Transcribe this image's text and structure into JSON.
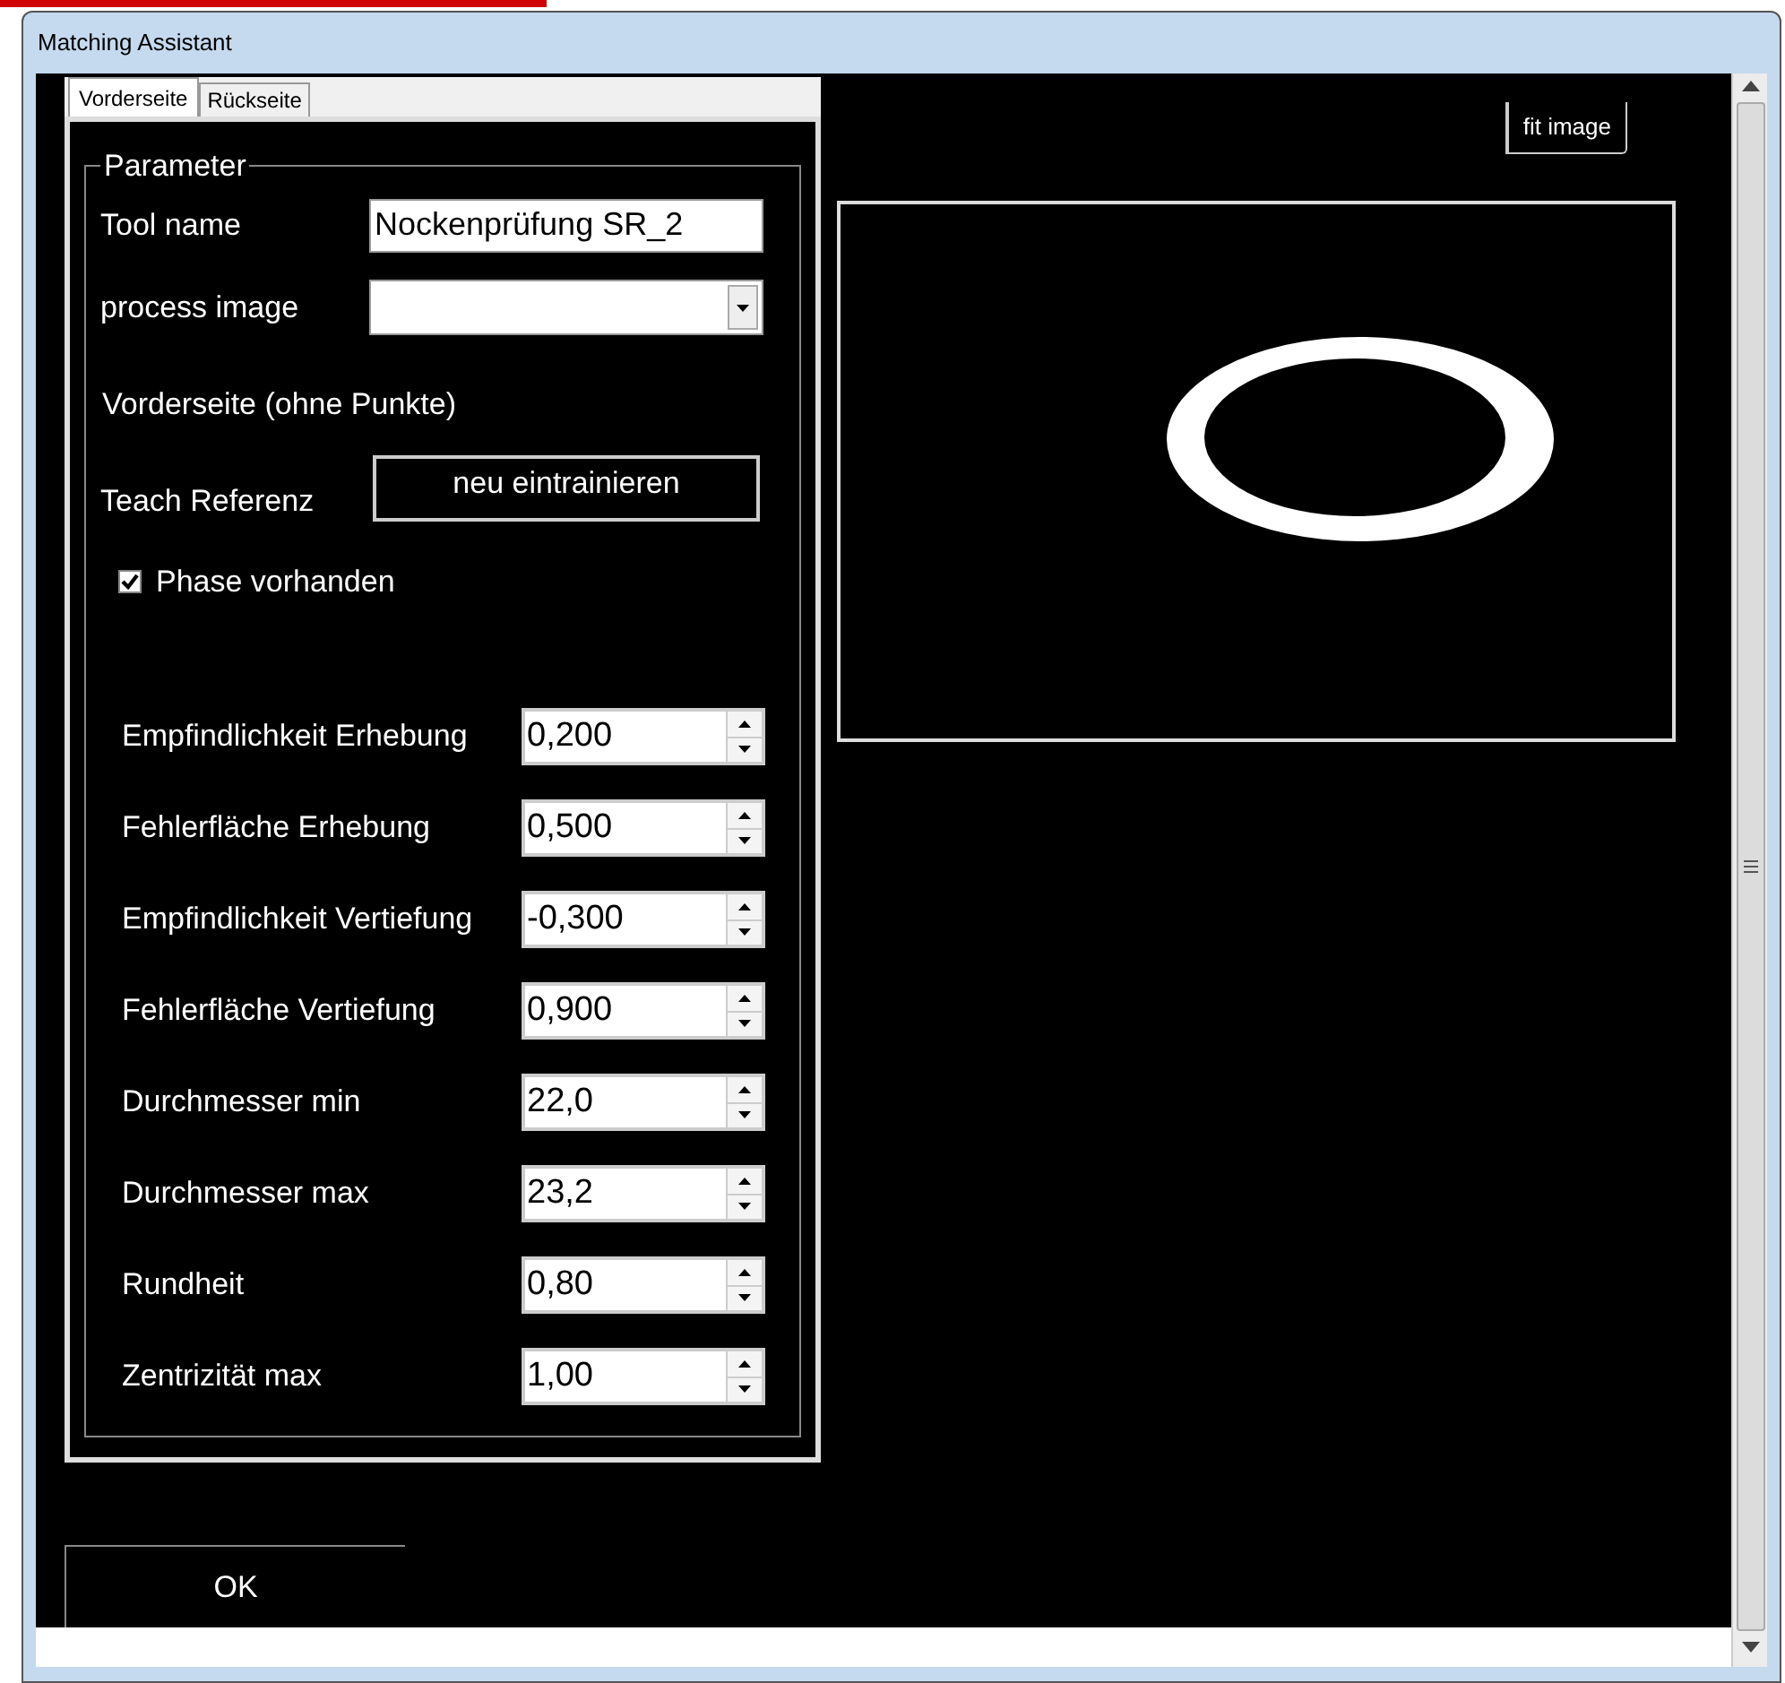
{
  "window": {
    "title": "Matching Assistant"
  },
  "tabs": [
    {
      "label": "Vorderseite",
      "selected": true
    },
    {
      "label": "Rückseite",
      "selected": false
    }
  ],
  "parameter_group": {
    "title": "Parameter",
    "tool_name": {
      "label": "Tool name",
      "value": "Nockenprüfung SR_2"
    },
    "process_image": {
      "label": "process image"
    },
    "note": "Vorderseite (ohne Punkte)",
    "teach": {
      "label": "Teach Referenz",
      "button": "neu eintrainieren"
    },
    "checkbox": {
      "label": "Phase vorhanden",
      "checked": true
    },
    "params": [
      {
        "label": "Empfindlichkeit Erhebung",
        "value": "0,200"
      },
      {
        "label": "Fehlerfläche Erhebung",
        "value": "0,500"
      },
      {
        "label": "Empfindlichkeit Vertiefung",
        "value": "-0,300"
      },
      {
        "label": "Fehlerfläche Vertiefung",
        "value": "0,900"
      },
      {
        "label": "Durchmesser min",
        "value": "22,0"
      },
      {
        "label": "Durchmesser max",
        "value": "23,2"
      },
      {
        "label": "Rundheit",
        "value": "0,80"
      },
      {
        "label": "Zentrizität max",
        "value": "1,00"
      }
    ]
  },
  "viewer": {
    "fit_button": "fit image"
  },
  "ok_button": "OK"
}
